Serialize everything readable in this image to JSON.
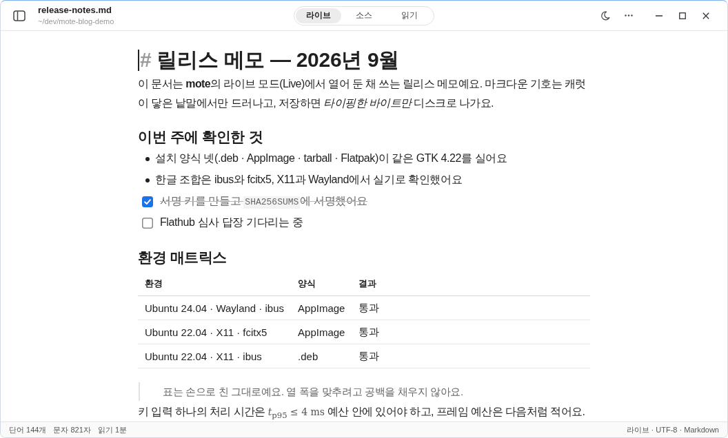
{
  "window": {
    "file_name": "release-notes.md",
    "path": "~/dev/mote-blog-demo"
  },
  "mode_tabs": [
    {
      "label": "라이브",
      "selected": true
    },
    {
      "label": "소스",
      "selected": false
    },
    {
      "label": "읽기",
      "selected": false
    }
  ],
  "document": {
    "blocks": [
      {
        "kind": "h1",
        "marker": "#",
        "caret": true,
        "text": "릴리스 메모 — 2026년 9월"
      },
      {
        "kind": "paragraph",
        "parts": [
          {
            "kind": "text",
            "text": "이 문서는 **mote**의 라이브 모드(Live)에서 열어 둔 채 쓰는 릴리스 메모예요. 마크다운 기호는 캐럿이 닿은 낱말에서만 드러나고, 저장하면 *타이핑한 바이트만* 디스크로 나가요."
          }
        ]
      },
      {
        "kind": "h2",
        "text": "이번 주에 확인한 것"
      },
      {
        "kind": "list",
        "items": [
          {
            "kind": "bullet",
            "parts": [
              {
                "kind": "text",
                "text": "설치 양식 넷(.deb · AppImage · tarball · Flatpak)이 같은 GTK 4.22를 실어요"
              }
            ]
          },
          {
            "kind": "bullet",
            "parts": [
              {
                "kind": "text",
                "text": "한글 조합은 ibus와 fcitx5, X11과 Wayland에서 실기로 확인했어요"
              }
            ]
          },
          {
            "kind": "task",
            "checked": true,
            "parts": [
              {
                "kind": "text",
                "text": "서명 키를 만들고 "
              },
              {
                "kind": "code",
                "text": "SHA256SUMS"
              },
              {
                "kind": "text",
                "text": "에 서명했어요"
              }
            ]
          },
          {
            "kind": "task",
            "checked": false,
            "parts": [
              {
                "kind": "text",
                "text": "Flathub 심사 답장 기다리는 중"
              }
            ]
          }
        ]
      },
      {
        "kind": "h2",
        "text": "환경 매트릭스"
      },
      {
        "kind": "table",
        "columns": [
          "환경",
          "양식",
          "결과"
        ],
        "rows": [
          [
            "Ubuntu 24.04 · Wayland · ibus",
            "AppImage",
            "통과"
          ],
          [
            "Ubuntu 22.04 · X11 · fcitx5",
            "AppImage",
            "통과"
          ],
          [
            "Ubuntu 22.04 · X11 · ibus",
            ".deb",
            "통과"
          ]
        ]
      },
      {
        "kind": "blockquote",
        "text": "표는 손으로 친 그대로예요. 열 폭을 맞추려고 공백을 채우지 않아요."
      },
      {
        "kind": "paragraph",
        "parts": [
          {
            "kind": "text",
            "text": "키 입력 하나의 처리 시간은 "
          },
          {
            "kind": "math",
            "text": "*t*$_{p95}$ ≤ 4 ms"
          },
          {
            "kind": "text",
            "text": " 예산 안에 있어야 하고, 프레임 예산은 다음처럼 적어요."
          }
        ]
      }
    ]
  },
  "status_bar": {
    "left": [
      "단어 144개",
      "문자 821자",
      "읽기 1분"
    ],
    "right": "라이브 · UTF-8 · Markdown"
  }
}
